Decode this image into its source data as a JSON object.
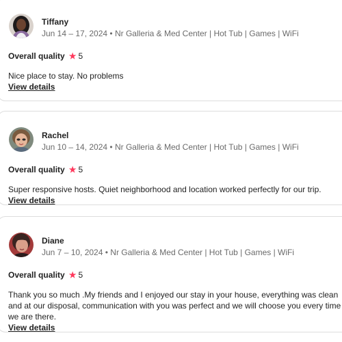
{
  "reviews": [
    {
      "name": "Tiffany",
      "meta": "Jun 14 – 17, 2024 • Nr Galleria & Med Center | Hot Tub | Games | WiFi",
      "quality_label": "Overall quality",
      "star": "★",
      "score": "5",
      "comment": "Nice place to stay. No problems",
      "details_label": "View details",
      "avatar_icon": "person-photo-icon"
    },
    {
      "name": "Rachel",
      "meta": "Jun 10 – 14, 2024 • Nr Galleria & Med Center | Hot Tub | Games | WiFi",
      "quality_label": "Overall quality",
      "star": "★",
      "score": "5",
      "comment": "Super responsive hosts. Quiet neighborhood and location worked perfectly for our trip.",
      "details_label": "View details",
      "avatar_icon": "person-photo-icon"
    },
    {
      "name": "Diane",
      "meta": "Jun 7 – 10, 2024 • Nr Galleria & Med Center | Hot Tub | Games | WiFi",
      "quality_label": "Overall quality",
      "star": "★",
      "score": "5",
      "comment": "Thank you so much .My friends and I enjoyed our stay in your house, everything was clean and at our disposal, communication with you was perfect and we will choose you every time we are there.",
      "details_label": "View details",
      "avatar_icon": "person-photo-icon"
    }
  ],
  "colors": {
    "star": "#ff385c",
    "text": "#222222",
    "muted": "#6a6a6a",
    "border": "#dddddd"
  }
}
